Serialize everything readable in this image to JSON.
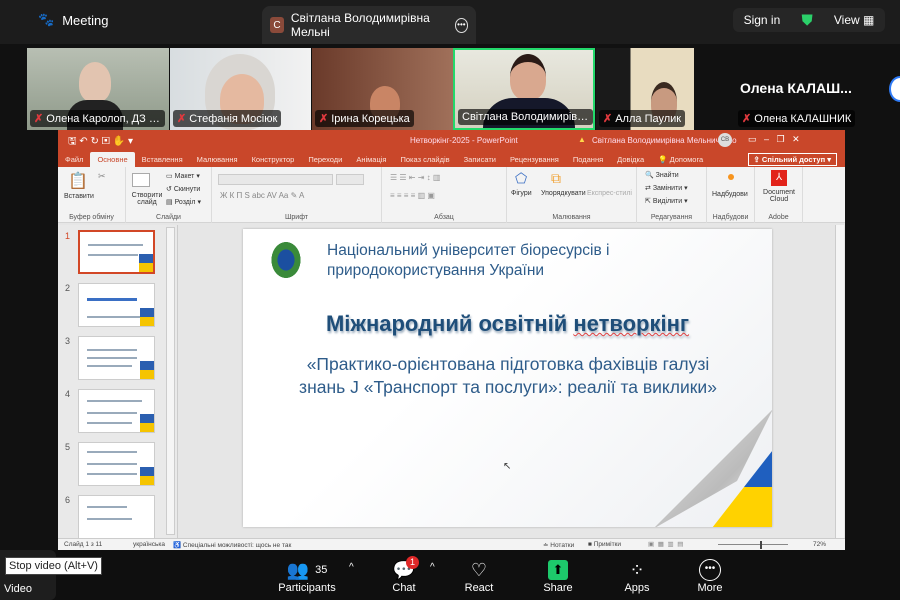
{
  "topbar": {
    "meeting_label": "Meeting",
    "tab_initial": "С",
    "tab_title": "Світлана Володимирівна Мельні",
    "sign_in": "Sign in",
    "view": "View"
  },
  "participants": [
    {
      "name": "Олена Каролоп, ДЗ Л...",
      "muted": true
    },
    {
      "name": "Стефанія Мосіюк",
      "muted": true
    },
    {
      "name": "Ірина Корецька",
      "muted": true
    },
    {
      "name": "Світлана Володимирівна...",
      "muted": false,
      "active_speaker": true
    },
    {
      "name": "Алла Паулик",
      "muted": true
    },
    {
      "name": "Олена КАЛАШНИК",
      "muted": true,
      "display_name": "Олена  КАЛАШ..."
    }
  ],
  "powerpoint": {
    "title": "Нетворкінг-2025  -  PowerPoint",
    "user": "Світлана Володимирівна Мельниченко",
    "user_initials": "СВ",
    "share_button": "Спільний доступ",
    "tabs": [
      "Файл",
      "Основне",
      "Вставлення",
      "Малювання",
      "Конструктор",
      "Переходи",
      "Анімація",
      "Показ слайдів",
      "Записати",
      "Рецензування",
      "Подання",
      "Довідка",
      "Допомога"
    ],
    "active_tab": "Основне",
    "ribbon": {
      "paste": "Вставити",
      "clipboard": "Буфер обміну",
      "new_slide": "Створити слайд",
      "layout": "Макет",
      "reset": "Скинути",
      "section": "Розділ",
      "slides": "Слайди",
      "font": "Шрифт",
      "paragraph": "Абзац",
      "shapes": "Фігури",
      "arrange": "Упорядкувати",
      "quick_styles": "Експрес-стилі",
      "drawing": "Малювання",
      "find": "Знайти",
      "replace": "Замінити",
      "select": "Виділити",
      "editing": "Редагування",
      "addins": "Надбудови",
      "addins_group": "Надбудови",
      "doc_cloud": "Document Cloud",
      "adobe": "Adobe"
    },
    "slide_numbers": [
      "1",
      "2",
      "3",
      "4",
      "5",
      "6"
    ],
    "selected_slide": 1,
    "slide": {
      "university_line1": "Національний університет біоресурсів і",
      "university_line2": "природокористування України",
      "title_part1": "Міжнародний освітній ",
      "title_part2": "нетворкінг",
      "subtitle": "«Практико-орієнтована підготовка фахівців галузі знань J «Транспорт та послуги»: реалії та виклики»"
    },
    "status": {
      "slide_of": "Слайд 1 з 11",
      "language": "українська",
      "accessibility": "Спеціальні можливості: щось не так",
      "notes": "Нотатки",
      "comments": "Примітки",
      "zoom": "72%"
    }
  },
  "bottombar": {
    "tooltip": "Stop video (Alt+V)",
    "video": "Video",
    "participants": "Participants",
    "participant_count": "35",
    "chat": "Chat",
    "chat_badge": "1",
    "react": "React",
    "share": "Share",
    "apps": "Apps",
    "more": "More"
  },
  "colors": {
    "ppt_orange": "#c9472a",
    "active_speaker": "#23d96b",
    "share_green": "#1dc96b",
    "slide_title": "#1f4e79",
    "slide_text": "#2e5c8a"
  }
}
